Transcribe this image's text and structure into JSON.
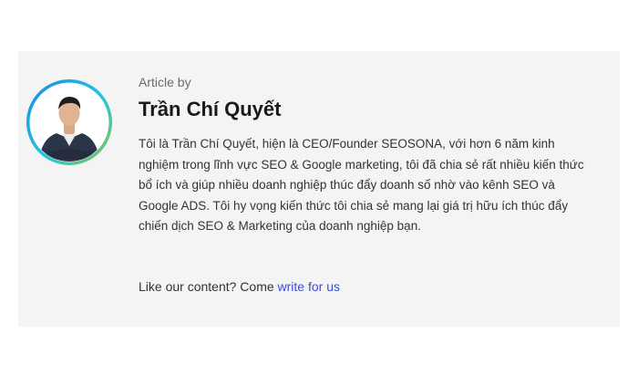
{
  "author_box": {
    "byline": "Article by",
    "name": "Trần Chí Quyết",
    "bio": "Tôi là Trần Chí Quyết, hiện là CEO/Founder SEOSONA, với hơn 6 năm kinh nghiệm trong lĩnh vực SEO & Google marketing, tôi đã chia sẻ rất nhiều kiến thức bổ ích và giúp nhiều doanh nghiệp thúc đẩy doanh số nhờ vào kênh SEO và Google ADS. Tôi hy vọng kiến thức tôi chia sẻ mang lại giá trị hữu ích thúc đẩy chiến dịch SEO & Marketing của doanh nghiệp bạn.",
    "cta_text": "Like our content? Come ",
    "cta_link": "write for us"
  },
  "colors": {
    "card_background": "#f4f4f4",
    "link": "#3b4cd8",
    "ring_gradient": [
      "#1e88e5",
      "#26c6da",
      "#8bc34a"
    ]
  }
}
